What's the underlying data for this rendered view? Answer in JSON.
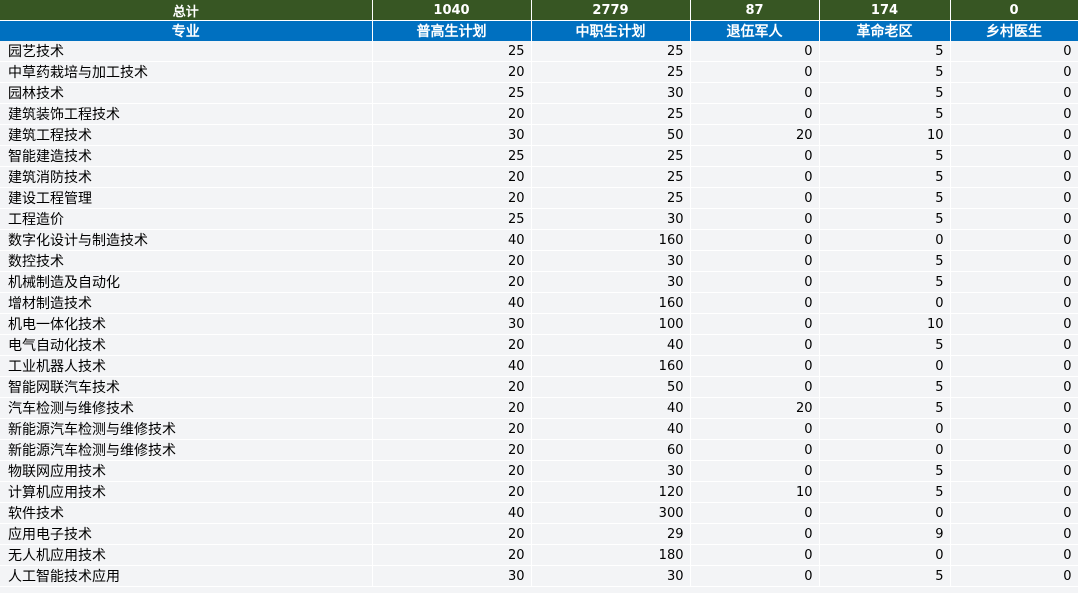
{
  "totals": {
    "label": "总计",
    "general": "1040",
    "vocational": "2779",
    "veterans": "87",
    "revolutionary": "174",
    "rural_doctor": "0"
  },
  "headers": {
    "major": "专业",
    "general": "普高生计划",
    "vocational": "中职生计划",
    "veterans": "退伍军人",
    "revolutionary": "革命老区",
    "rural_doctor": "乡村医生"
  },
  "rows": [
    {
      "major": "园艺技术",
      "general": "25",
      "vocational": "25",
      "veterans": "0",
      "revolutionary": "5",
      "rural_doctor": "0"
    },
    {
      "major": "中草药栽培与加工技术",
      "general": "20",
      "vocational": "25",
      "veterans": "0",
      "revolutionary": "5",
      "rural_doctor": "0"
    },
    {
      "major": "园林技术",
      "general": "25",
      "vocational": "30",
      "veterans": "0",
      "revolutionary": "5",
      "rural_doctor": "0"
    },
    {
      "major": "建筑装饰工程技术",
      "general": "20",
      "vocational": "25",
      "veterans": "0",
      "revolutionary": "5",
      "rural_doctor": "0"
    },
    {
      "major": "建筑工程技术",
      "general": "30",
      "vocational": "50",
      "veterans": "20",
      "revolutionary": "10",
      "rural_doctor": "0"
    },
    {
      "major": "智能建造技术",
      "general": "25",
      "vocational": "25",
      "veterans": "0",
      "revolutionary": "5",
      "rural_doctor": "0"
    },
    {
      "major": "建筑消防技术",
      "general": "20",
      "vocational": "25",
      "veterans": "0",
      "revolutionary": "5",
      "rural_doctor": "0"
    },
    {
      "major": "建设工程管理",
      "general": "20",
      "vocational": "25",
      "veterans": "0",
      "revolutionary": "5",
      "rural_doctor": "0"
    },
    {
      "major": "工程造价",
      "general": "25",
      "vocational": "30",
      "veterans": "0",
      "revolutionary": "5",
      "rural_doctor": "0"
    },
    {
      "major": "数字化设计与制造技术",
      "general": "40",
      "vocational": "160",
      "veterans": "0",
      "revolutionary": "0",
      "rural_doctor": "0"
    },
    {
      "major": "数控技术",
      "general": "20",
      "vocational": "30",
      "veterans": "0",
      "revolutionary": "5",
      "rural_doctor": "0"
    },
    {
      "major": "机械制造及自动化",
      "general": "20",
      "vocational": "30",
      "veterans": "0",
      "revolutionary": "5",
      "rural_doctor": "0"
    },
    {
      "major": "增材制造技术",
      "general": "40",
      "vocational": "160",
      "veterans": "0",
      "revolutionary": "0",
      "rural_doctor": "0"
    },
    {
      "major": "机电一体化技术",
      "general": "30",
      "vocational": "100",
      "veterans": "0",
      "revolutionary": "10",
      "rural_doctor": "0"
    },
    {
      "major": "电气自动化技术",
      "general": "20",
      "vocational": "40",
      "veterans": "0",
      "revolutionary": "5",
      "rural_doctor": "0"
    },
    {
      "major": "工业机器人技术",
      "general": "40",
      "vocational": "160",
      "veterans": "0",
      "revolutionary": "0",
      "rural_doctor": "0"
    },
    {
      "major": "智能网联汽车技术",
      "general": "20",
      "vocational": "50",
      "veterans": "0",
      "revolutionary": "5",
      "rural_doctor": "0"
    },
    {
      "major": "汽车检测与维修技术",
      "general": "20",
      "vocational": "40",
      "veterans": "20",
      "revolutionary": "5",
      "rural_doctor": "0"
    },
    {
      "major": "新能源汽车检测与维修技术",
      "general": "20",
      "vocational": "40",
      "veterans": "0",
      "revolutionary": "0",
      "rural_doctor": "0"
    },
    {
      "major": "新能源汽车检测与维修技术",
      "general": "20",
      "vocational": "60",
      "veterans": "0",
      "revolutionary": "0",
      "rural_doctor": "0"
    },
    {
      "major": "物联网应用技术",
      "general": "20",
      "vocational": "30",
      "veterans": "0",
      "revolutionary": "5",
      "rural_doctor": "0"
    },
    {
      "major": "计算机应用技术",
      "general": "20",
      "vocational": "120",
      "veterans": "10",
      "revolutionary": "5",
      "rural_doctor": "0"
    },
    {
      "major": "软件技术",
      "general": "40",
      "vocational": "300",
      "veterans": "0",
      "revolutionary": "0",
      "rural_doctor": "0"
    },
    {
      "major": "应用电子技术",
      "general": "20",
      "vocational": "29",
      "veterans": "0",
      "revolutionary": "9",
      "rural_doctor": "0"
    },
    {
      "major": "无人机应用技术",
      "general": "20",
      "vocational": "180",
      "veterans": "0",
      "revolutionary": "0",
      "rural_doctor": "0"
    },
    {
      "major": "人工智能技术应用",
      "general": "30",
      "vocational": "30",
      "veterans": "0",
      "revolutionary": "5",
      "rural_doctor": "0"
    }
  ]
}
